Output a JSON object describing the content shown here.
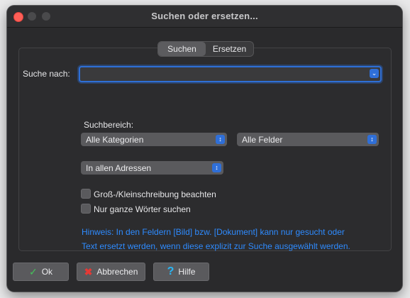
{
  "window": {
    "title": "Suchen oder ersetzen..."
  },
  "tabs": [
    {
      "label": "Suchen",
      "active": true
    },
    {
      "label": "Ersetzen",
      "active": false
    }
  ],
  "search": {
    "label": "Suche nach:",
    "value": ""
  },
  "scope": {
    "label": "Suchbereich:",
    "category_selected": "Alle Kategorien",
    "field_selected": "Alle Felder",
    "address_selected": "In allen Adressen"
  },
  "options": {
    "case_label": "Groß-/Kleinschreibung beachten",
    "case_checked": false,
    "whole_words_label": "Nur ganze Wörter suchen",
    "whole_words_checked": false
  },
  "hint": {
    "line1": "Hinweis: In den Feldern [Bild] bzw. [Dokument] kann nur gesucht oder",
    "line2": "Text ersetzt werden, wenn diese explizit zur Suche ausgewählt werden."
  },
  "buttons": {
    "ok_label": "Ok",
    "cancel_label": "Abbrechen",
    "help_label": "Hilfe"
  },
  "icons": {
    "ok": "checkmark-icon",
    "cancel": "x-icon",
    "help": "question-mark-icon"
  },
  "colors": {
    "accent": "#2f6fd8",
    "hint_text": "#2e8bff",
    "close_light": "#fe5f57"
  }
}
